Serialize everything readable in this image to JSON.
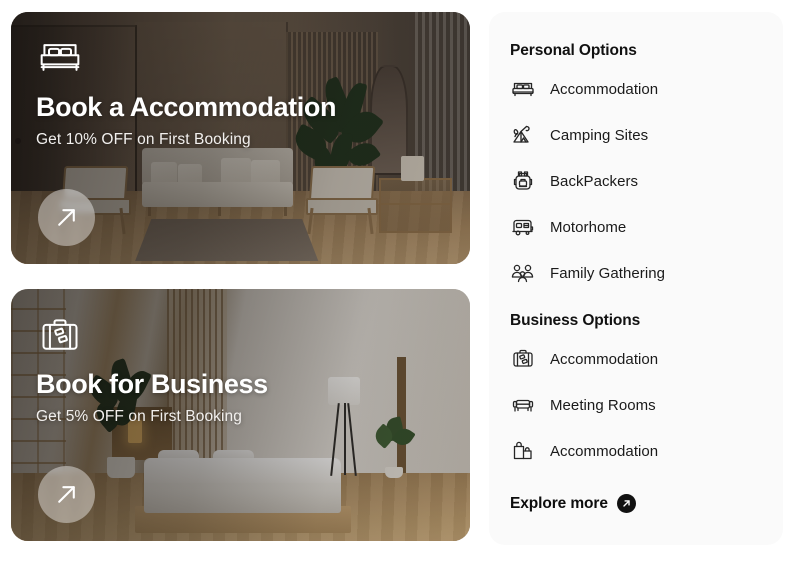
{
  "promo_cards": [
    {
      "icon": "bed-icon",
      "title": "Book a Accommodation",
      "subtitle": "Get 10% OFF on First Booking",
      "cta_icon": "arrow-up-right-icon",
      "scene": "living-room"
    },
    {
      "icon": "suitcase-icon",
      "title": "Book for Business",
      "subtitle": "Get 5% OFF on First Booking",
      "cta_icon": "arrow-up-right-icon",
      "scene": "bedroom"
    }
  ],
  "panel": {
    "personal": {
      "title": "Personal Options",
      "items": [
        {
          "label": "Accommodation",
          "icon": "bed-icon"
        },
        {
          "label": "Camping Sites",
          "icon": "tent-icon"
        },
        {
          "label": "BackPackers",
          "icon": "backpack-icon"
        },
        {
          "label": "Motorhome",
          "icon": "caravan-icon"
        },
        {
          "label": "Family Gathering",
          "icon": "family-group-icon"
        }
      ]
    },
    "business": {
      "title": "Business Options",
      "items": [
        {
          "label": "Accommodation",
          "icon": "briefcase-icon"
        },
        {
          "label": "Meeting Rooms",
          "icon": "armchair-icon"
        },
        {
          "label": "Accommodation",
          "icon": "shopping-bags-icon"
        }
      ]
    },
    "explore": {
      "label": "Explore more",
      "icon": "arrow-up-right-badge-icon"
    }
  },
  "colors": {
    "panel_background": "#fafafa",
    "page_background": "#ffffff",
    "text_primary": "#111111",
    "badge_background": "#111111",
    "card_text": "#ffffff"
  }
}
